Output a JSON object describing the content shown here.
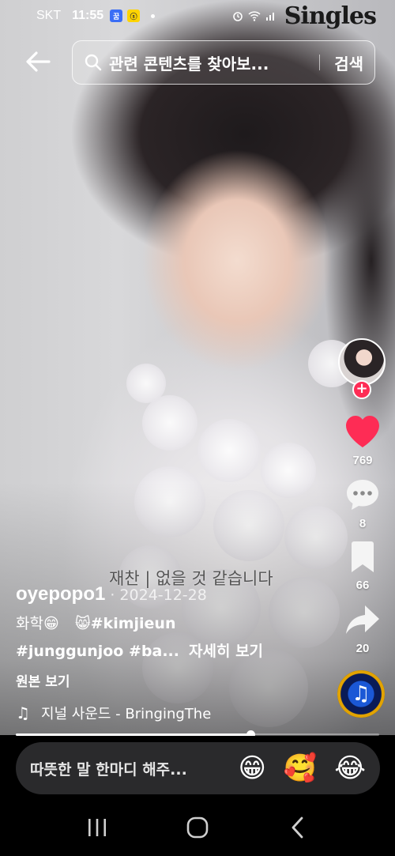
{
  "status_bar": {
    "carrier": "SKT",
    "time": "11:55",
    "badge_1": "꿈",
    "badge_2": "ⓢ",
    "brand": "Singles"
  },
  "search": {
    "query": "관련 콘텐츠를 찾아보...",
    "button_label": "검색"
  },
  "actions": {
    "likes": "769",
    "comments": "8",
    "bookmarks": "66",
    "shares": "20"
  },
  "video": {
    "subtitle": "재찬 | 없을 것 같습니다",
    "progress_fraction": 0.645
  },
  "caption": {
    "author": "oyepopo1",
    "date": "· 2024-12-28",
    "line1_text": "화학😁",
    "line1_tags": "😸#kimjieun",
    "line2_tags": "#junggunjoo #ba...",
    "more": "자세히 보기",
    "original": "원본 보기",
    "sound": "지널 사운드 - BringingThe"
  },
  "comment_bar": {
    "placeholder": "따뜻한 말 한마디 해주...",
    "emojis": [
      "😁",
      "🥰",
      "😂"
    ]
  },
  "colors": {
    "like": "#fe2c55",
    "follow": "#fe2c55",
    "pill": "#2a2a2c"
  },
  "icons": [
    "back-arrow-icon",
    "search-icon",
    "heart-icon",
    "comment-icon",
    "bookmark-icon",
    "share-icon",
    "music-note-icon",
    "recents-icon",
    "home-icon",
    "nav-back-icon"
  ]
}
